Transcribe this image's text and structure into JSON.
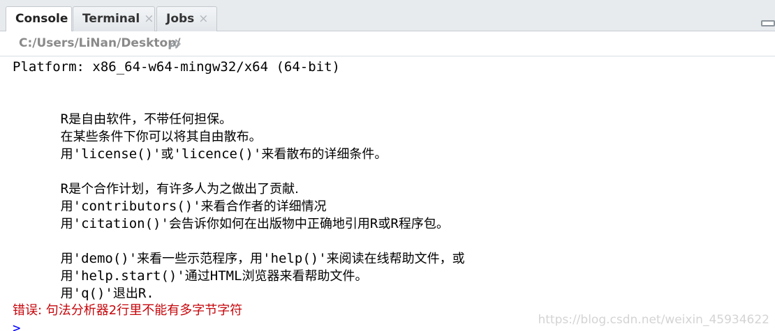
{
  "tabs": [
    {
      "label": "Console",
      "active": true,
      "closable": false
    },
    {
      "label": "Terminal",
      "active": false,
      "closable": true
    },
    {
      "label": "Jobs",
      "active": false,
      "closable": true
    }
  ],
  "close_glyph": "×",
  "path": "C:/Users/LiNan/Desktop/",
  "console": {
    "platform": "Platform: x86_64-w64-mingw32/x64 (64-bit)",
    "lines": [
      {
        "parts": [
          "R",
          "是自由软件，不带任何担保。"
        ]
      },
      {
        "parts": [
          "",
          "在某些条件下你可以将其自由散布。"
        ]
      },
      {
        "parts": [
          "",
          "用",
          "'license()'",
          "或",
          "'licence()'",
          "来看散布的详细条件。"
        ]
      },
      {
        "parts": [
          "R",
          "是个合作计划，有许多人为之做出了贡献."
        ]
      },
      {
        "parts": [
          "",
          "用",
          "'contributors()'",
          "来看合作者的详细情况"
        ]
      },
      {
        "parts": [
          "",
          "用",
          "'citation()'",
          "会告诉你如何在出版物中正确地引用",
          "R",
          "或",
          "R",
          "程序包。"
        ]
      },
      {
        "parts": [
          "",
          "用",
          "'demo()'",
          "来看一些示范程序，用",
          "'help()'",
          "来阅读在线帮助文件，或"
        ]
      },
      {
        "parts": [
          "",
          "用",
          "'help.start()'",
          "通过",
          "HTML",
          "浏览器来看帮助文件。"
        ]
      },
      {
        "parts": [
          "",
          "用",
          "'q()'",
          "退出",
          "R."
        ]
      }
    ],
    "error": "错误: 句法分析器2行里不能有多字节字符",
    "prompt": ">"
  },
  "watermark": "https://blog.csdn.net/weixin_45934622",
  "colors": {
    "error": "#c5060b",
    "prompt": "#0000ff",
    "path": "#8a8a8a"
  }
}
